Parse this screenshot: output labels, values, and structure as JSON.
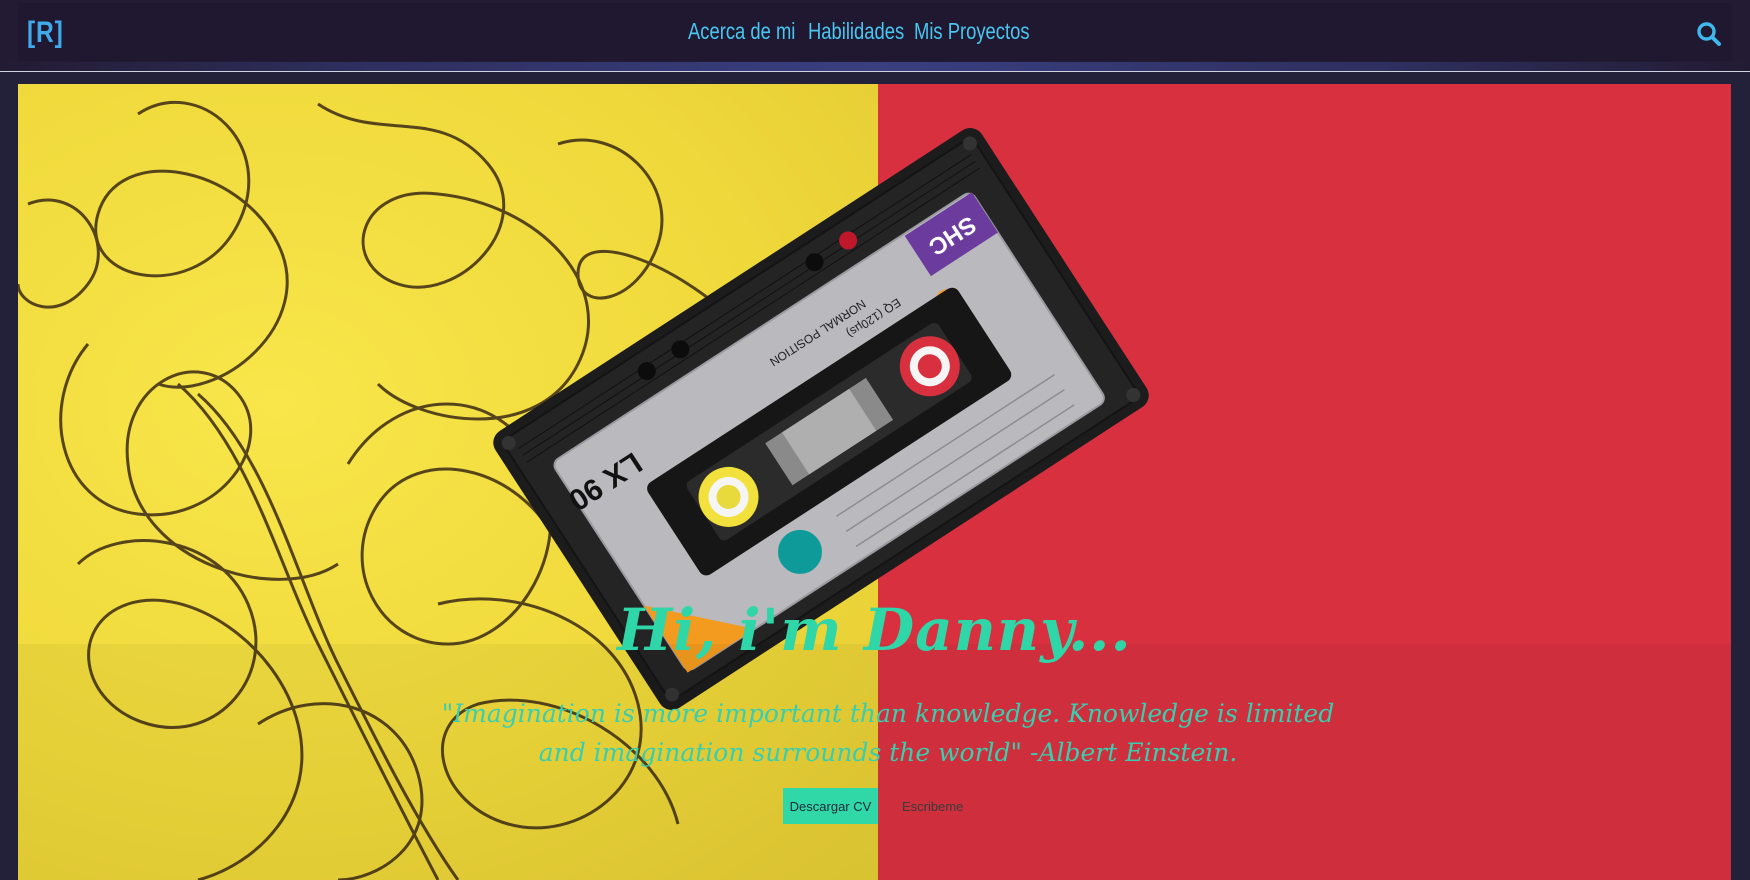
{
  "header": {
    "brand": "[R]",
    "nav": [
      {
        "label": "Acerca de mi"
      },
      {
        "label": "Habilidades"
      },
      {
        "label": "Mis Proyectos"
      }
    ],
    "search_icon": "search-icon"
  },
  "hero": {
    "title": "Hi, i'm Danny...",
    "quote": "\"Imagination is more important than knowledge. Knowledge is limited and imagination surrounds the world\" -Albert Einstein.",
    "cassette_label": "LX 90",
    "cassette_brand": "SHC",
    "cassette_small_1": "NORMAL POSITION",
    "cassette_small_2": "EQ (120µs)",
    "buttons": {
      "download_cv": "Descargar CV",
      "write_me": "Escribeme"
    }
  },
  "colors": {
    "nav_bg": "#231b33",
    "link": "#49c6f0",
    "accent": "#2fd8a6",
    "yellow": "#f3e03c",
    "red": "#d8303f"
  }
}
